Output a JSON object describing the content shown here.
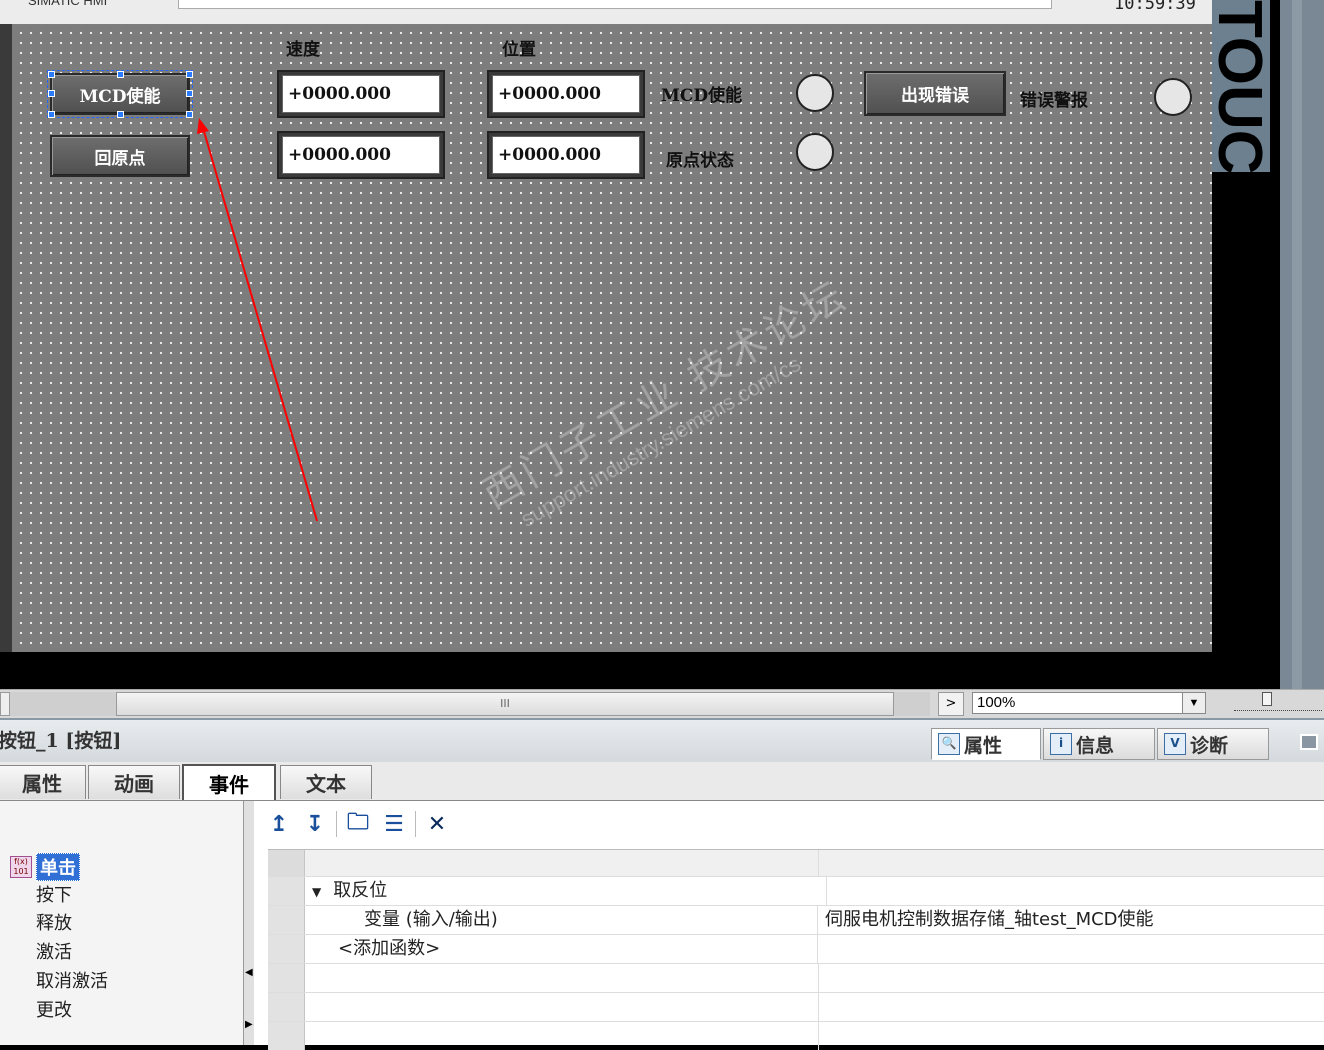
{
  "hmi": {
    "brand": "SIMATIC HMI",
    "clock": "10:59:39",
    "side_label": "TOUCH",
    "buttons": {
      "mcd_enable": "MCD使能",
      "home": "回原点",
      "error": "出现错误"
    },
    "labels": {
      "speed": "速度",
      "position": "位置",
      "mcd_enable_status": "MCD使能",
      "home_status": "原点状态",
      "error_alarm": "错误警报"
    },
    "fields": {
      "speed_1": "+0000.000",
      "position_1": "+0000.000",
      "speed_2": "+0000.000",
      "position_2": "+0000.000"
    },
    "watermark": {
      "cn": "西门子工业 技术论坛",
      "en": "support.industry.siemens.com/cs"
    }
  },
  "scrollbar": {
    "grip": "III",
    "nav": ">",
    "zoom": "100%",
    "dropdown": "▼"
  },
  "properties": {
    "title": "按钮_1 [按钮]",
    "inspector_tabs": [
      {
        "label": "属性",
        "icon": "properties-icon",
        "glyph": "🔍"
      },
      {
        "label": "信息",
        "icon": "info-icon",
        "glyph": "i"
      },
      {
        "label": "诊断",
        "icon": "diagnostics-icon",
        "glyph": "V"
      }
    ],
    "subtabs": [
      "属性",
      "动画",
      "事件",
      "文本"
    ],
    "active_subtab": "事件",
    "events": {
      "selected": "单击",
      "items": [
        "按下",
        "释放",
        "激活",
        "取消激活",
        "更改"
      ]
    },
    "toolbar": [
      "move-up-icon",
      "move-down-icon",
      "folder-icon",
      "list-icon",
      "delete-icon"
    ],
    "function_list": {
      "function": "取反位",
      "param_name": "变量 (输入/输出)",
      "param_value": "伺服电机控制数据存储_轴test_MCD使能",
      "add": "<添加函数>"
    }
  },
  "colors": {
    "arrow": "#ff0000",
    "selection": "#2b7bff",
    "event_highlight": "#2f6fd6"
  }
}
